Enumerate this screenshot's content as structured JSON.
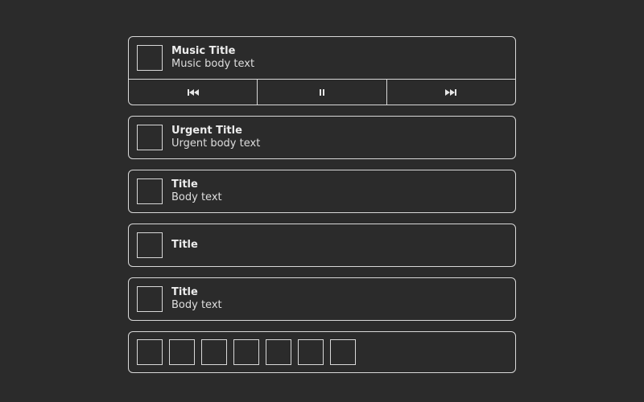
{
  "notifications": [
    {
      "type": "music",
      "title": "Music Title",
      "body": "Music body text"
    },
    {
      "type": "urgent",
      "title": "Urgent Title",
      "body": "Urgent body text"
    },
    {
      "type": "normal",
      "title": "Title",
      "body": "Body text"
    },
    {
      "type": "title-only",
      "title": "Title"
    },
    {
      "type": "normal",
      "title": "Title",
      "body": "Body text"
    }
  ],
  "music_controls": [
    {
      "icon": "previous-track-icon"
    },
    {
      "icon": "pause-icon"
    },
    {
      "icon": "next-track-icon"
    }
  ],
  "image_strip": {
    "count": 7
  },
  "colors": {
    "background": "#2b2b2b",
    "border": "#d8d8d8",
    "text": "#e6e6e6"
  }
}
